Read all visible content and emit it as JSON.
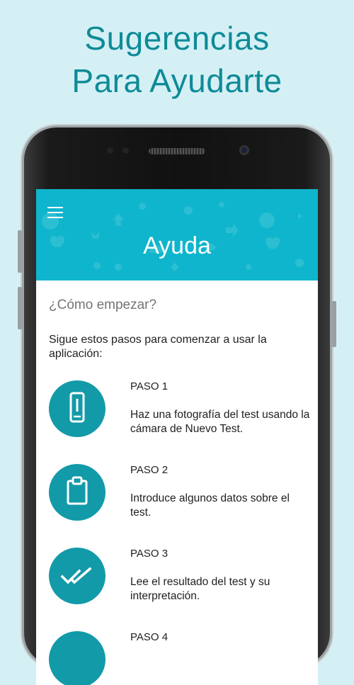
{
  "promo": {
    "title_line1": "Sugerencias",
    "title_line2": "Para Ayudarte"
  },
  "app_bar": {
    "menu_icon": "hamburger-menu-icon",
    "title": "Ayuda",
    "color": "#0fb5cc"
  },
  "content": {
    "section_title": "¿Cómo empezar?",
    "intro": "Sigue estos pasos para comenzar a usar la aplicación:",
    "steps": [
      {
        "label": "PASO 1",
        "description": "Haz una fotografía del test usando la cámara de Nuevo Test.",
        "icon": "phone-icon"
      },
      {
        "label": "PASO 2",
        "description": "Introduce algunos datos sobre el test.",
        "icon": "clipboard-icon"
      },
      {
        "label": "PASO 3",
        "description": "Lee el resultado del test y su interpretación.",
        "icon": "double-check-icon"
      },
      {
        "label": "PASO 4",
        "icon": "step-4-icon"
      }
    ]
  },
  "colors": {
    "background": "#d5f0f5",
    "promo_text": "#0e8b97",
    "step_circle": "#139aa8"
  }
}
